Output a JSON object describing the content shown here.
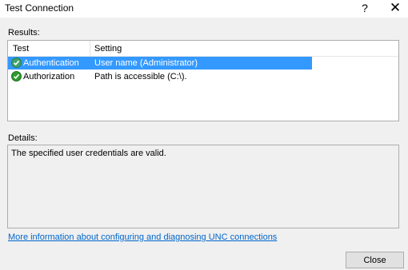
{
  "window": {
    "title": "Test Connection",
    "help_glyph": "?",
    "close_glyph": "✕"
  },
  "results": {
    "label": "Results:",
    "columns": [
      "Test",
      "Setting"
    ],
    "rows": [
      {
        "test": "Authentication",
        "setting": "User name (Administrator)",
        "icon": "success-check-icon",
        "selected": true
      },
      {
        "test": "Authorization",
        "setting": "Path is accessible (C:\\).",
        "icon": "success-check-icon",
        "selected": false
      }
    ]
  },
  "details": {
    "label": "Details:",
    "text": "The specified user credentials are valid."
  },
  "help_link": "More information about configuring and diagnosing UNC connections",
  "buttons": {
    "close": "Close"
  },
  "colors": {
    "selection": "#3399ff",
    "link": "#0066cc",
    "success": "#2e9b2e"
  }
}
